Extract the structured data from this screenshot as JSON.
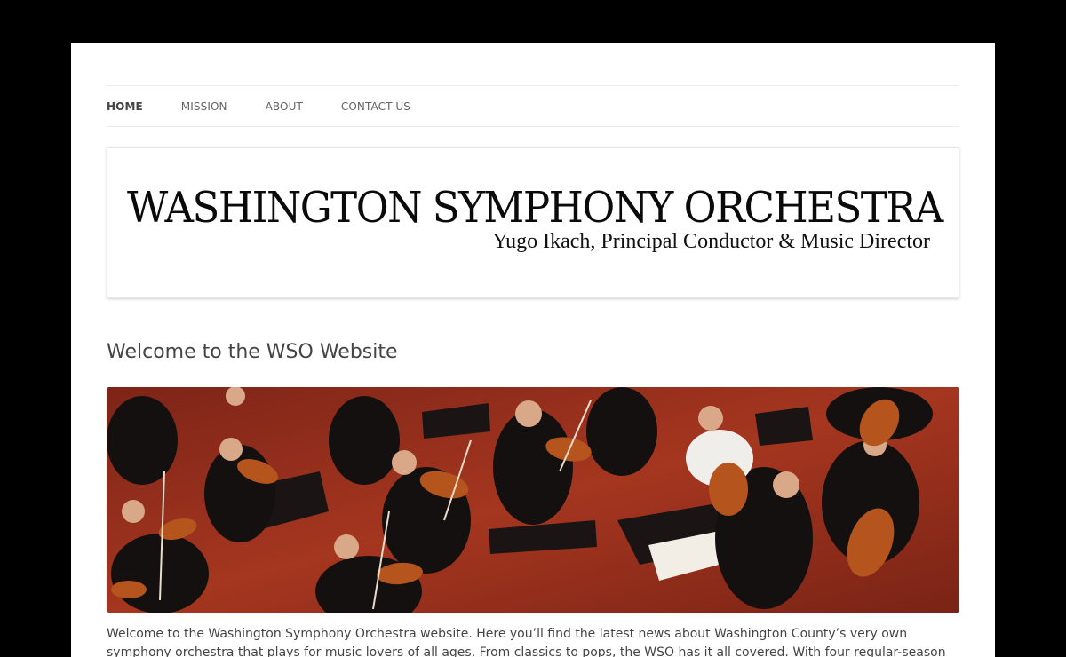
{
  "nav": {
    "items": [
      {
        "label": "HOME",
        "active": true
      },
      {
        "label": "MISSION",
        "active": false
      },
      {
        "label": "ABOUT",
        "active": false
      },
      {
        "label": "CONTACT US",
        "active": false
      }
    ]
  },
  "header": {
    "title": "WASHINGTON SYMPHONY ORCHESTRA",
    "subtitle": "Yugo Ikach, Principal Conductor & Music Director"
  },
  "post": {
    "title": "Welcome to the WSO Website",
    "image_desc_icon": "orchestra-photo",
    "body": "Welcome to the Washington Symphony Orchestra website. Here you’ll find the latest news about Washington County’s very own symphony orchestra that plays for music lovers of all ages. From classics to pops, the WSO has it all covered. With four regular-season concerts, great music is"
  },
  "colors": {
    "frame": "#000000",
    "page": "#ffffff",
    "text": "#444444",
    "stage_red": "#8f2a1a"
  }
}
